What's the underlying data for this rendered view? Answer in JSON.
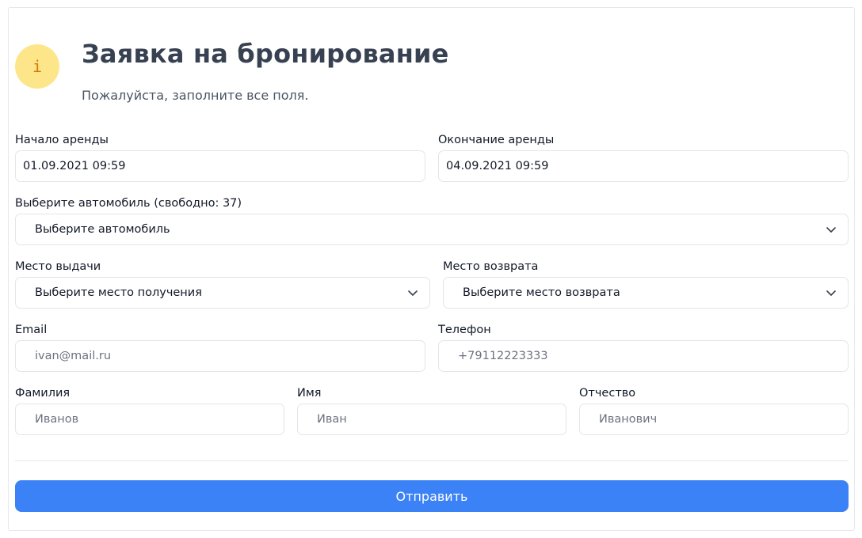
{
  "header": {
    "icon": "info-icon",
    "icon_glyph": "i",
    "title": "Заявка на бронирование",
    "subtitle": "Пожалуйста, заполните все поля."
  },
  "rental_start": {
    "label": "Начало аренды",
    "value": "01.09.2021 09:59"
  },
  "rental_end": {
    "label": "Окончание аренды",
    "value": "04.09.2021 09:59"
  },
  "car": {
    "label": "Выберите автомобиль (свободно: 37)",
    "selected": "Выберите автомобиль"
  },
  "pickup": {
    "label": "Место выдачи",
    "selected": "Выберите место получения"
  },
  "return": {
    "label": "Место возврата",
    "selected": "Выберите место возврата"
  },
  "email": {
    "label": "Email",
    "placeholder": "ivan@mail.ru"
  },
  "phone": {
    "label": "Телефон",
    "placeholder": "+79112223333"
  },
  "last_name": {
    "label": "Фамилия",
    "placeholder": "Иванов"
  },
  "first_name": {
    "label": "Имя",
    "placeholder": "Иван"
  },
  "middle_name": {
    "label": "Отчество",
    "placeholder": "Иванович"
  },
  "submit": {
    "label": "Отправить"
  },
  "colors": {
    "accent": "#3b82f6",
    "icon_bg": "#fde68a",
    "icon_fg": "#d97706"
  }
}
